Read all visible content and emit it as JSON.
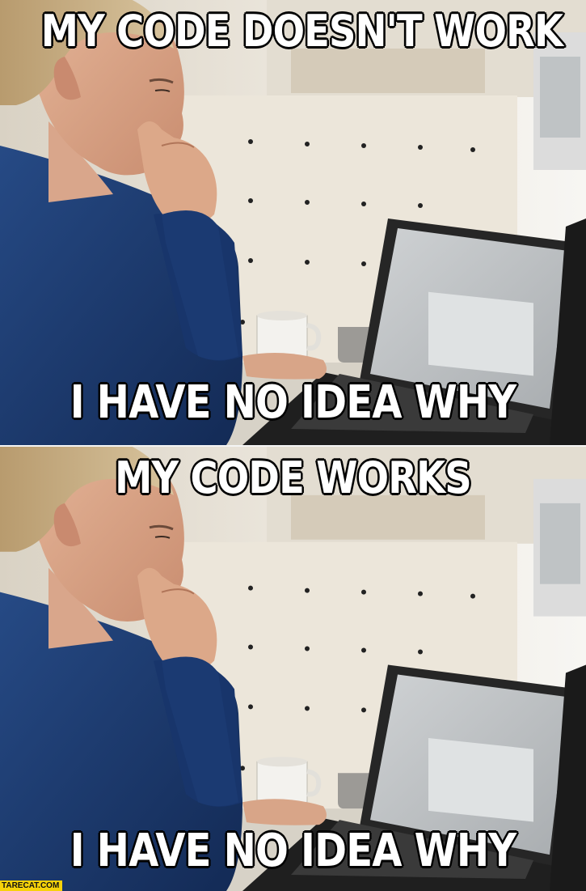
{
  "meme": {
    "top_panel": {
      "caption_top": "MY CODE DOESN'T WORK",
      "caption_bottom": "I HAVE NO IDEA WHY"
    },
    "bottom_panel": {
      "caption_top": "MY CODE WORKS",
      "caption_bottom": "I HAVE NO IDEA WHY"
    },
    "watermark": "TARECAT.COM"
  },
  "colors": {
    "caption_fill": "#ffffff",
    "caption_stroke": "#000000",
    "sweater": "#1d3a6e",
    "wall": "#e9e3d8",
    "laptop": "#2b2b2b",
    "watermark_bg": "#f6d20a"
  }
}
